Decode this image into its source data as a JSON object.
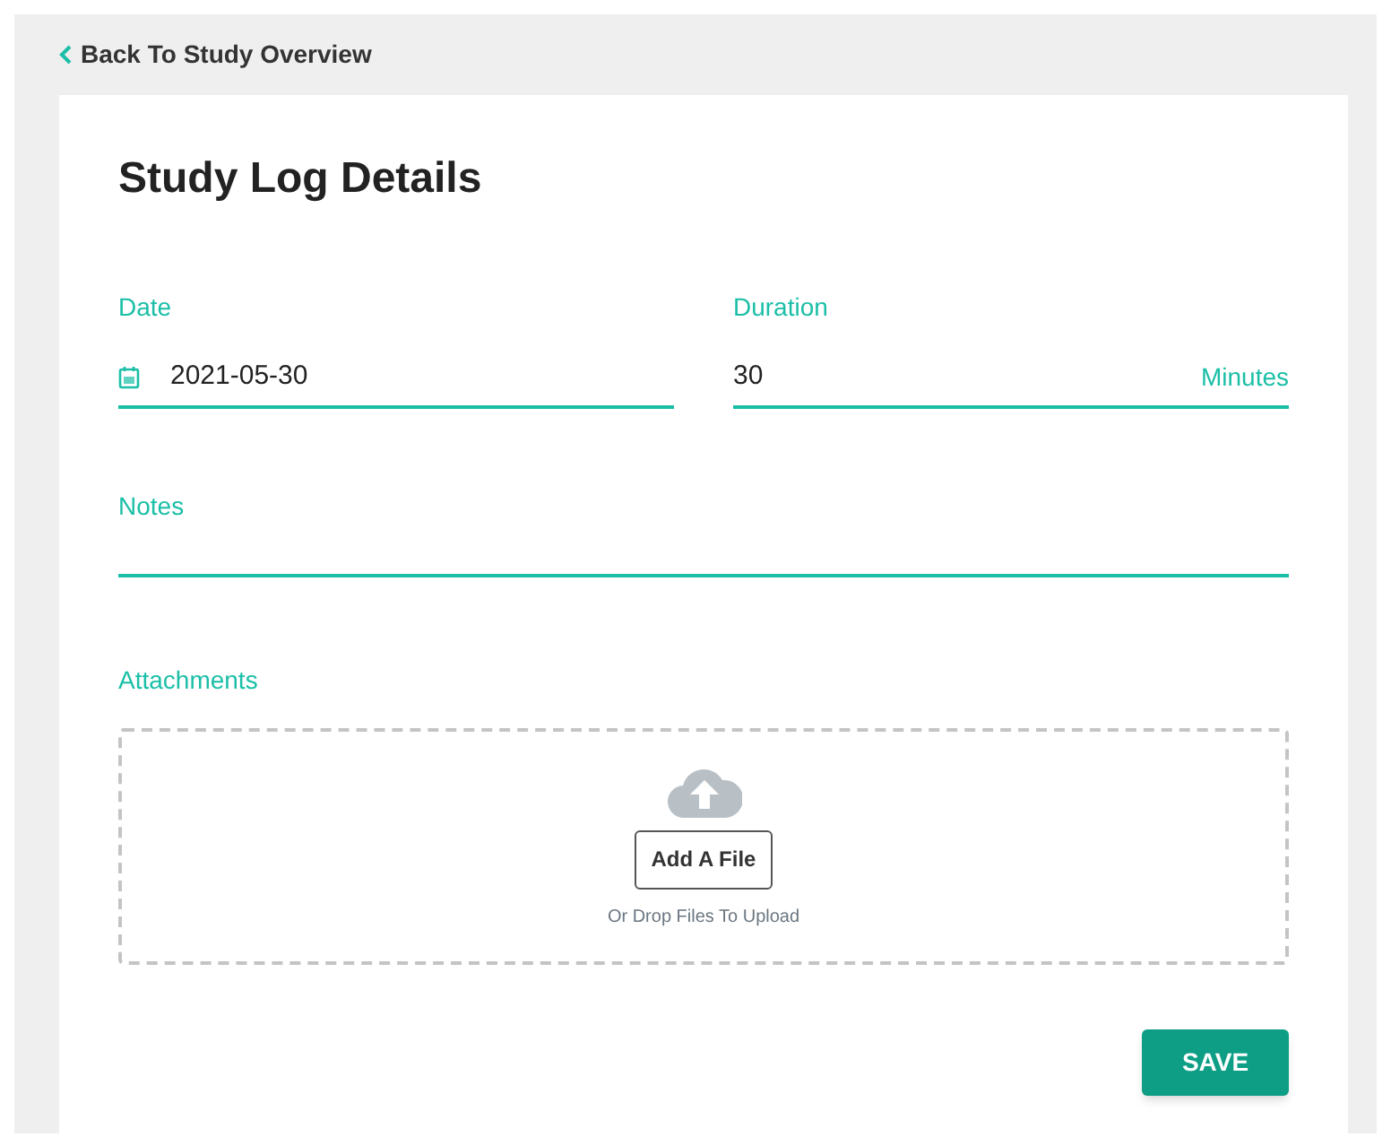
{
  "back_link": "Back To Study Overview",
  "title": "Study Log Details",
  "date": {
    "label": "Date",
    "value": "2021-05-30"
  },
  "duration": {
    "label": "Duration",
    "value": "30",
    "unit": "Minutes"
  },
  "notes": {
    "label": "Notes"
  },
  "attachments": {
    "label": "Attachments",
    "button": "Add A File",
    "hint": "Or Drop Files To Upload"
  },
  "save_button": "SAVE"
}
